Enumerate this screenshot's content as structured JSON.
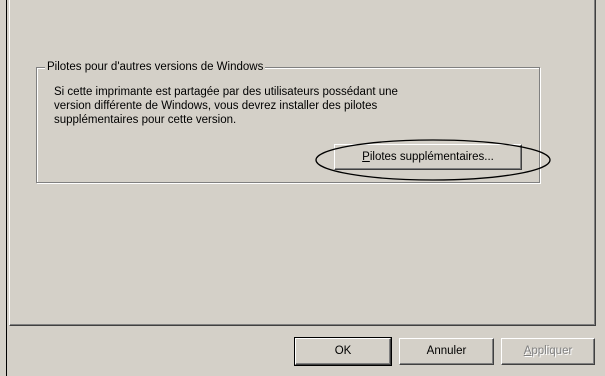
{
  "groupbox": {
    "title": "Pilotes pour d'autres versions de Windows",
    "description_lines": [
      "Si cette imprimante est partagée par des utilisateurs possédant une",
      "version différente de Windows, vous devrez installer des pilotes",
      "supplémentaires pour cette version."
    ],
    "extra_drivers_button": "Pilotes supplémentaires..."
  },
  "buttons": {
    "ok": "OK",
    "cancel": "Annuler",
    "apply": "Appliquer",
    "apply_disabled": true
  },
  "colors": {
    "face": "#d4d0c8",
    "shadow": "#808080",
    "dark_shadow": "#404040",
    "highlight": "#ffffff",
    "disabled_text": "#808080"
  }
}
